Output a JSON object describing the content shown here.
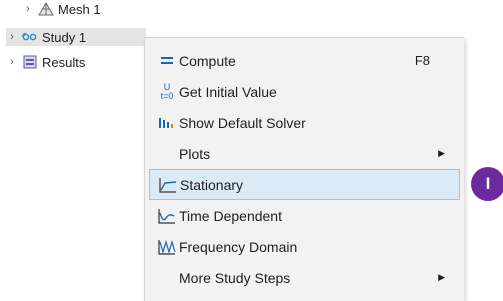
{
  "tree": {
    "mesh": {
      "label": "Mesh 1",
      "icon": "mesh-icon"
    },
    "study": {
      "label": "Study 1",
      "icon": "study-icon"
    },
    "results": {
      "label": "Results",
      "icon": "results-icon"
    },
    "chevron": "›"
  },
  "menu": {
    "compute": {
      "label": "Compute",
      "shortcut": "F8",
      "icon": "compute-icon"
    },
    "initial": {
      "label": "Get Initial Value",
      "icon": "initial-value-icon",
      "icon_text_top": "U",
      "icon_text_bottom": "t=0"
    },
    "solver": {
      "label": "Show Default Solver",
      "icon": "solver-icon"
    },
    "plots": {
      "label": "Plots",
      "arrow": "▶"
    },
    "stationary": {
      "label": "Stationary",
      "icon": "stationary-icon"
    },
    "time": {
      "label": "Time Dependent",
      "icon": "time-dependent-icon"
    },
    "frequency": {
      "label": "Frequency Domain",
      "icon": "frequency-domain-icon"
    },
    "more": {
      "label": "More Study Steps",
      "arrow": "▶"
    }
  },
  "callout": {
    "label": "I",
    "color": "#6b2aa0"
  },
  "colors": {
    "highlight": "#dbeaf7",
    "highlight_border": "#99c6ec",
    "menu_bg": "#f2f2f2"
  }
}
